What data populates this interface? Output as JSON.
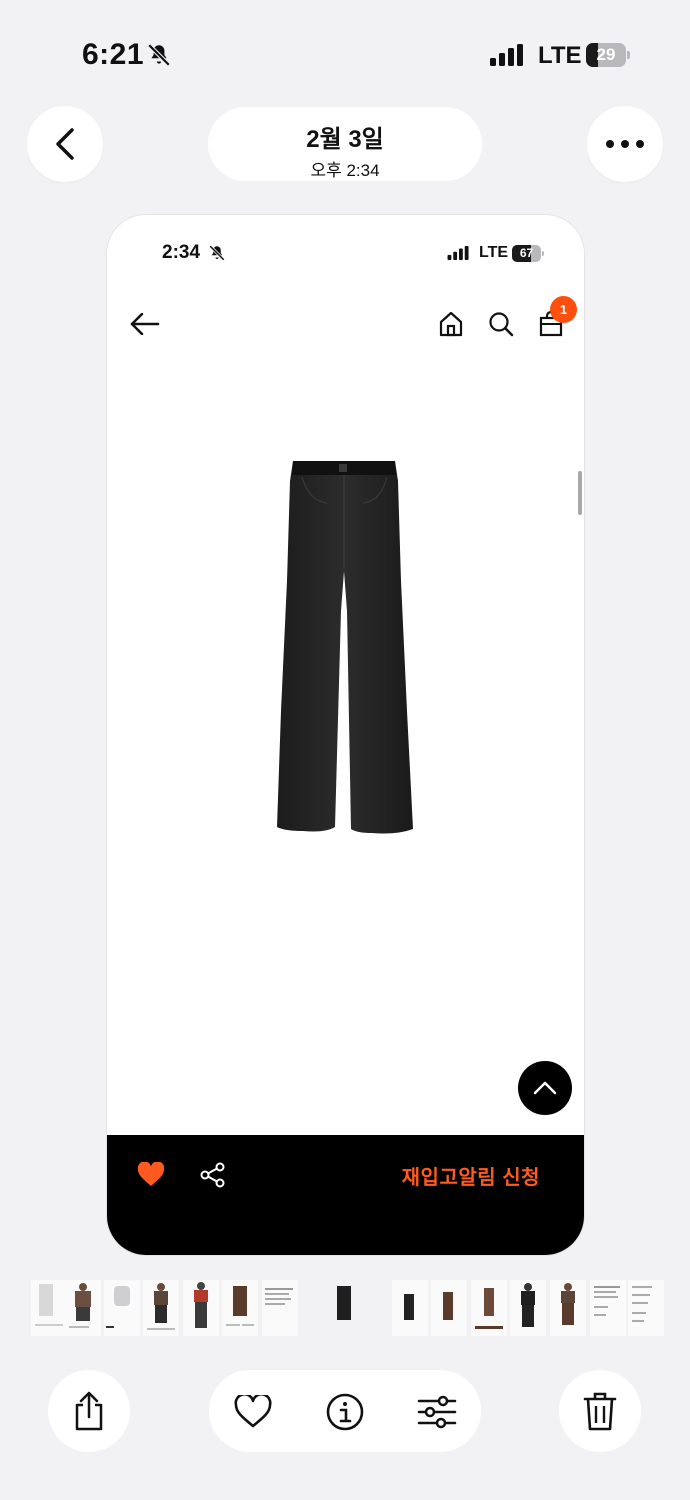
{
  "status_bar": {
    "time": "6:21",
    "network": "LTE",
    "battery": "29",
    "battery_level": 0.29
  },
  "header": {
    "date": "2월 3일",
    "time": "오후 2:34"
  },
  "screenshot": {
    "status_bar": {
      "time": "2:34",
      "network": "LTE",
      "battery": "67",
      "battery_level": 0.67
    },
    "cart_badge": "1",
    "product_image": "black-wide-leg-denim-pants",
    "bottom_bar": {
      "restock_label": "재입고알림 신청",
      "accent_color": "#ff5a1f"
    }
  },
  "icons": {
    "back": "chevron-left-icon",
    "more": "ellipsis-icon",
    "home": "home-icon",
    "search": "search-icon",
    "bag": "shopping-bag-icon",
    "scroll_top": "chevron-up-icon",
    "heart": "heart-icon",
    "share": "share-icon",
    "toolbar_share": "share-up-icon",
    "favorite": "heart-outline-icon",
    "info": "info-icon",
    "adjust": "sliders-icon",
    "delete": "trash-icon"
  }
}
